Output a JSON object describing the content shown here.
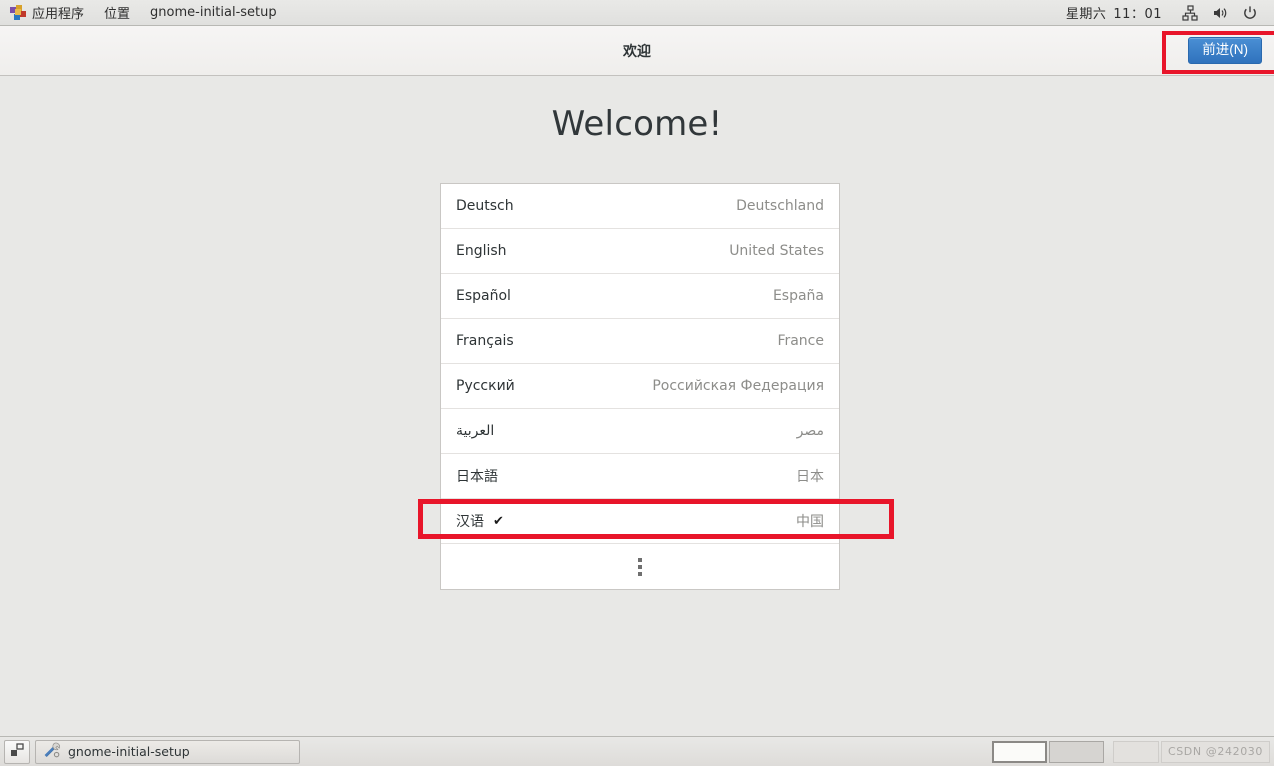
{
  "top_panel": {
    "apps_icon": "applications-pinwheel-icon",
    "applications_label": "应用程序",
    "places_label": "位置",
    "window_label": "gnome-initial-setup",
    "clock_day": "星期六",
    "clock_time": "11：01",
    "tray": [
      {
        "name": "network-icon",
        "label": "网络"
      },
      {
        "name": "volume-icon",
        "label": "音量"
      },
      {
        "name": "power-icon",
        "label": "电源"
      }
    ]
  },
  "header": {
    "title": "欢迎",
    "next_label": "前进(N)",
    "next_accent": "#2f72bd",
    "highlight_color": "#e8152a"
  },
  "main": {
    "welcome_heading": "Welcome!",
    "languages": [
      {
        "name": "Deutsch",
        "country": "Deutschland",
        "selected": false,
        "rtl": false
      },
      {
        "name": "English",
        "country": "United States",
        "selected": false,
        "rtl": false
      },
      {
        "name": "Español",
        "country": "España",
        "selected": false,
        "rtl": false
      },
      {
        "name": "Français",
        "country": "France",
        "selected": false,
        "rtl": false
      },
      {
        "name": "Русский",
        "country": "Российская Федерация",
        "selected": false,
        "rtl": false
      },
      {
        "name": "العربية",
        "country": "مصر",
        "selected": false,
        "rtl": true
      },
      {
        "name": "日本語",
        "country": "日本",
        "selected": false,
        "rtl": false
      },
      {
        "name": "汉语",
        "country": "中国",
        "selected": true,
        "rtl": false
      }
    ],
    "selected_check_glyph": "✔",
    "more_row_icon": "more-vertical-icon"
  },
  "taskbar": {
    "show_desktop_icon": "show-desktop-icon",
    "task_icon": "tools-icon",
    "task_label": "gnome-initial-setup",
    "workspaces": [
      {
        "active": true
      },
      {
        "active": false
      }
    ],
    "watermark": "CSDN @242030"
  }
}
